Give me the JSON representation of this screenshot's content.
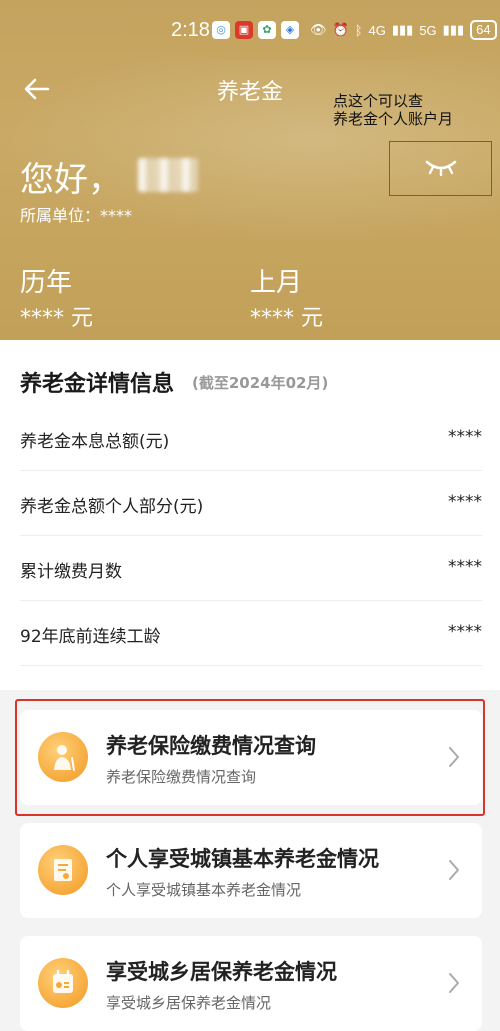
{
  "status_bar": {
    "time": "2:18",
    "signal_4g": "4G",
    "signal_5g": "5G",
    "battery": "64"
  },
  "nav": {
    "title": "养老金"
  },
  "annotation": {
    "line1": "点这个可以查",
    "line2": "养老金个人账户月"
  },
  "profile": {
    "greeting": "您好，",
    "unit_label": "所属单位：****"
  },
  "stats": [
    {
      "label": "历年",
      "value": "**** 元"
    },
    {
      "label": "上月",
      "value": "**** 元"
    }
  ],
  "details": {
    "title": "养老金详情信息",
    "subtitle": "(截至2024年02月)",
    "rows": [
      {
        "label": "养老金本息总额(元)",
        "value": "****"
      },
      {
        "label": "养老金总额个人部分(元)",
        "value": "****"
      },
      {
        "label": "累计缴费月数",
        "value": "****"
      },
      {
        "label": "92年底前连续工龄",
        "value": "****"
      }
    ]
  },
  "cards": [
    {
      "title": "养老保险缴费情况查询",
      "subtitle": "养老保险缴费情况查询",
      "icon": "elderly-person-icon"
    },
    {
      "title": "个人享受城镇基本养老金情况",
      "subtitle": "个人享受城镇基本养老金情况",
      "icon": "pension-document-icon"
    },
    {
      "title": "享受城乡居保养老金情况",
      "subtitle": "享受城乡居保养老金情况",
      "icon": "calendar-card-icon"
    }
  ],
  "colors": {
    "header_gold": "#c6a560",
    "highlight_red": "#d9342b",
    "icon_orange": "#f6a93b"
  }
}
